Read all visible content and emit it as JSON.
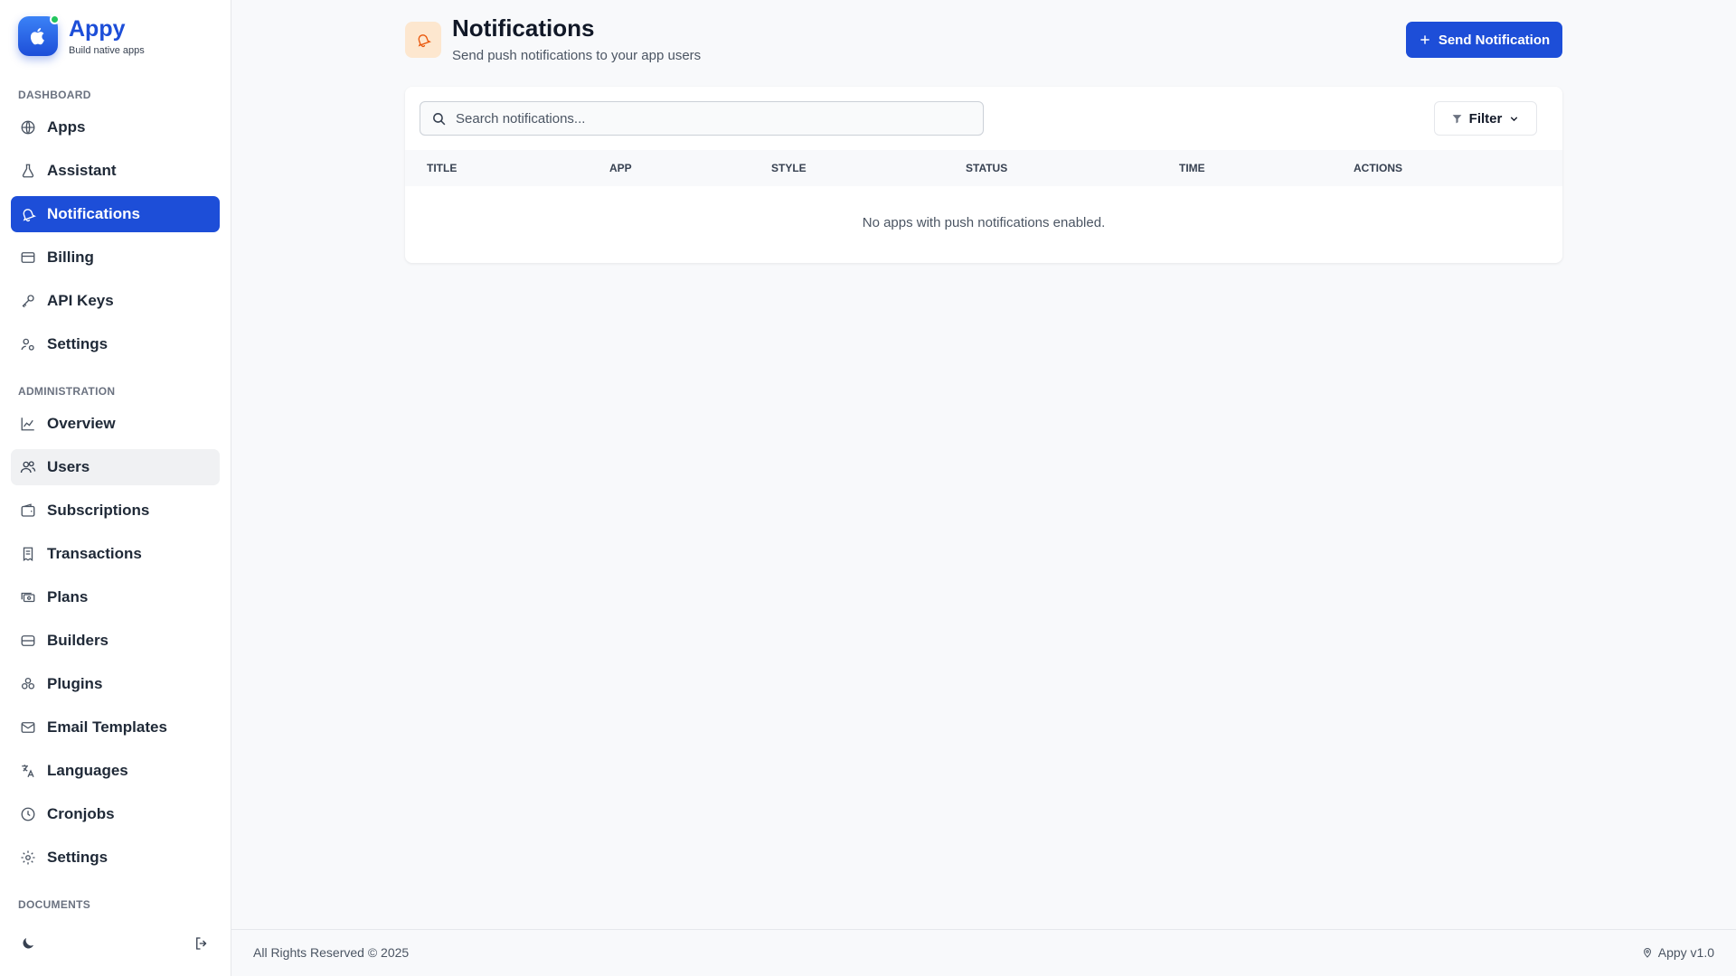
{
  "brand": {
    "name": "Appy",
    "tagline": "Build native apps",
    "accent": "#1d4ed8",
    "status_dot": "#22c55e",
    "logo_icon": "apple-icon"
  },
  "sidebar": {
    "sections": {
      "dashboard": "DASHBOARD",
      "administration": "ADMINISTRATION",
      "documents": "DOCUMENTS"
    },
    "dashboard_items": [
      {
        "label": "Apps",
        "icon": "globe-icon"
      },
      {
        "label": "Assistant",
        "icon": "flask-icon"
      },
      {
        "label": "Notifications",
        "icon": "bell-icon",
        "active": true
      },
      {
        "label": "Billing",
        "icon": "credit-card-icon"
      },
      {
        "label": "API Keys",
        "icon": "key-icon"
      },
      {
        "label": "Settings",
        "icon": "user-cog-icon"
      }
    ],
    "admin_items": [
      {
        "label": "Overview",
        "icon": "chart-line-icon"
      },
      {
        "label": "Users",
        "icon": "users-icon",
        "hover": true
      },
      {
        "label": "Subscriptions",
        "icon": "wallet-icon"
      },
      {
        "label": "Transactions",
        "icon": "receipt-icon"
      },
      {
        "label": "Plans",
        "icon": "cash-icon"
      },
      {
        "label": "Builders",
        "icon": "server-icon"
      },
      {
        "label": "Plugins",
        "icon": "puzzle-icon"
      },
      {
        "label": "Email Templates",
        "icon": "mail-icon"
      },
      {
        "label": "Languages",
        "icon": "translate-icon"
      },
      {
        "label": "Cronjobs",
        "icon": "clock-icon"
      },
      {
        "label": "Settings",
        "icon": "gear-icon"
      }
    ],
    "bottom": {
      "theme_icon": "moon-icon",
      "logout_icon": "logout-icon"
    }
  },
  "header": {
    "title": "Notifications",
    "subtitle": "Send push notifications to your app users",
    "icon": "bell-icon",
    "icon_bg": "#fde7cf",
    "icon_color": "#ea580c",
    "send_button": "Send Notification"
  },
  "toolbar": {
    "search_placeholder": "Search notifications...",
    "filter_label": "Filter"
  },
  "table": {
    "columns": [
      "TITLE",
      "APP",
      "STYLE",
      "STATUS",
      "TIME",
      "ACTIONS"
    ],
    "empty_message": "No apps with push notifications enabled."
  },
  "footer": {
    "copyright": "All Rights Reserved © 2025",
    "version": "Appy v1.0"
  }
}
